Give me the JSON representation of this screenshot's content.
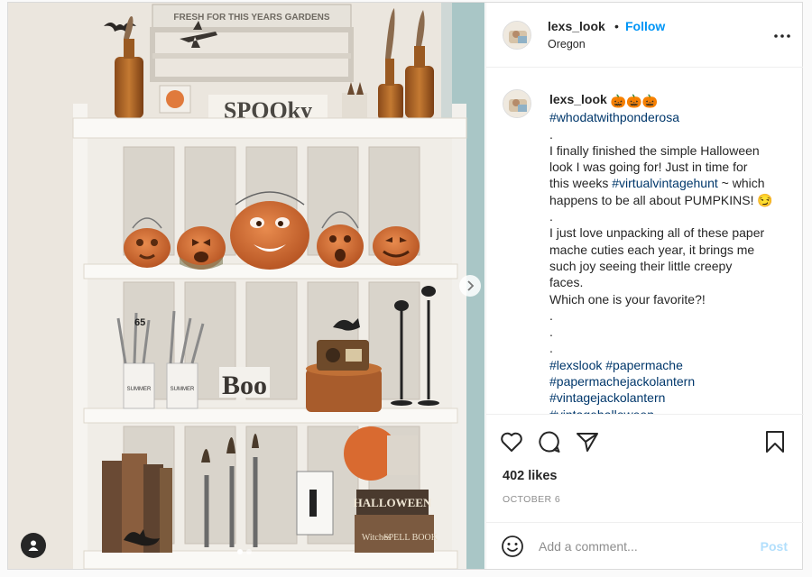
{
  "post": {
    "username": "lexs_look",
    "separator": "•",
    "follow_label": "Follow",
    "location": "Oregon",
    "more_icon": "more-horizontal-icon"
  },
  "photo": {
    "carousel_index": 1,
    "carousel_count": 2,
    "sign_text": "FRESH FOR THIS YEARS GARDENS",
    "spooky_text": "SPOOky",
    "boo_text": "Boo",
    "tin_text": "HALLOWEEN",
    "book_text": "SPELL BOOK",
    "book_text2": "Witches",
    "book_text3": "BOOK",
    "number_65": "65",
    "jar_text": "SUMMER"
  },
  "caption": {
    "username": "lexs_look",
    "emojis": "🎃🎃🎃",
    "hashtag_top": "#whodatwithponderosa",
    "lines": {
      "l1": ".",
      "l2": "I finally finished the simple Halloween",
      "l3": "look I was going for! Just in time for",
      "l4a": "this weeks ",
      "l4b": "#virtualvintagehunt",
      "l4c": " ~ which",
      "l5": "happens to be all about PUMPKINS! 😏",
      "l6": ".",
      "l7": "I just love unpacking all of these paper",
      "l8": "mache cuties each year, it brings me",
      "l9": "such joy seeing their little creepy",
      "l10": "faces.",
      "l11": "Which one is your favorite?!",
      "l12": ".",
      "l13": ".",
      "l14": ".",
      "h1": "#lexslook #papermache",
      "h2": "#papermachejackolantern",
      "h3": "#vintagejackolantern",
      "h4": "#vintagehalloween"
    }
  },
  "actions": {
    "like_icon": "heart-icon",
    "comment_icon": "comment-icon",
    "share_icon": "paper-plane-icon",
    "save_icon": "bookmark-icon",
    "likes": "402 likes",
    "date": "OCTOBER 6"
  },
  "comment": {
    "emoji_icon": "smiley-icon",
    "placeholder": "Add a comment...",
    "value": "",
    "post_label": "Post",
    "post_color": "#b2dffc"
  },
  "colors": {
    "accent": "#0095f6",
    "hashtag": "#00376b",
    "muted": "#8e8e8e"
  }
}
